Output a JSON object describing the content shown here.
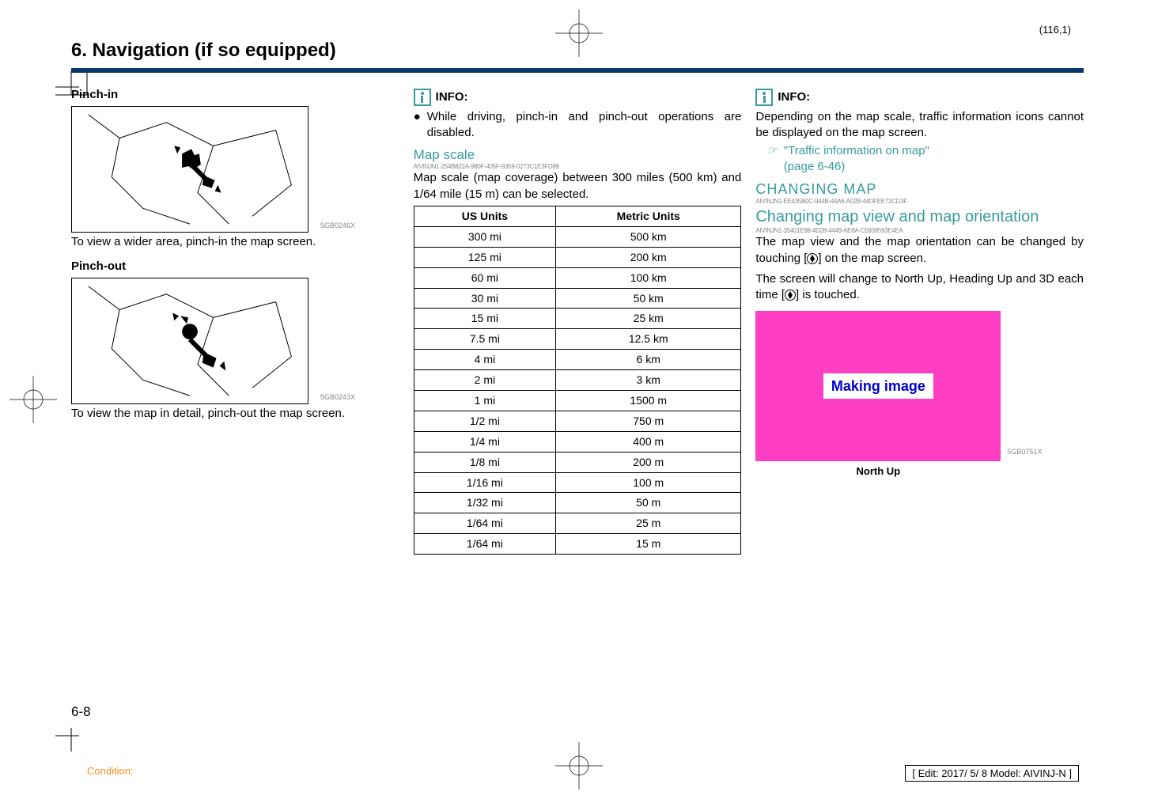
{
  "meta": {
    "pageCoord": "(116,1)",
    "condition": "Condition:",
    "editBox": "[ Edit: 2017/ 5/ 8    Model:  AIVINJ-N ]",
    "pageNumber": "6-8"
  },
  "chapterTitle": "6. Navigation (if so equipped)",
  "col1": {
    "h_pinchin": "Pinch-in",
    "fig1_label": "5GB0246X",
    "para_pinchin": "To view a wider area, pinch-in the map screen.",
    "h_pinchout": "Pinch-out",
    "fig2_label": "5GB0243X",
    "para_pinchout": "To view the map in detail, pinch-out the map screen."
  },
  "col2": {
    "info_label": "INFO:",
    "info_bullet": "While driving, pinch-in and pinch-out operations are disabled.",
    "mapscale_h": "Map scale",
    "mapscale_id": "AIVINJN1-254B822A-980F-405F-9359-0273C1E3FD89",
    "mapscale_para": "Map scale (map coverage) between 300 miles (500 km) and 1/64 mile (15 m) can be selected.",
    "th_us": "US Units",
    "th_metric": "Metric Units",
    "rows": [
      {
        "us": "300 mi",
        "m": "500 km"
      },
      {
        "us": "125 mi",
        "m": "200 km"
      },
      {
        "us": "60 mi",
        "m": "100 km"
      },
      {
        "us": "30 mi",
        "m": "50 km"
      },
      {
        "us": "15 mi",
        "m": "25 km"
      },
      {
        "us": "7.5 mi",
        "m": "12.5 km"
      },
      {
        "us": "4 mi",
        "m": "6 km"
      },
      {
        "us": "2 mi",
        "m": "3 km"
      },
      {
        "us": "1 mi",
        "m": "1500 m"
      },
      {
        "us": "1/2 mi",
        "m": "750 m"
      },
      {
        "us": "1/4 mi",
        "m": "400 m"
      },
      {
        "us": "1/8 mi",
        "m": "200 m"
      },
      {
        "us": "1/16 mi",
        "m": "100 m"
      },
      {
        "us": "1/32 mi",
        "m": "50 m"
      },
      {
        "us": "1/64 mi",
        "m": "25 m"
      },
      {
        "us": "1/64 mi",
        "m": "15 m"
      }
    ]
  },
  "col3": {
    "info_label": "INFO:",
    "info_para": "Depending on the map scale, traffic information icons cannot be displayed on the map screen.",
    "ref_text1": "\"Traffic information on map\"",
    "ref_text2": "(page 6-46)",
    "changing_h": "CHANGING MAP",
    "changing_id": "AIVINJN1-EE435B0C-944B-44A6-A02B-44DFEE72CD3F",
    "changing_sub": "Changing map view and map orientation",
    "changing_sub_id": "AIVINJN1-35401E88-4D28-4449-AE8A-C5939593E4EA",
    "para1a": "The map view and the map orientation can be changed by touching [",
    "para1b": "] on the map screen.",
    "para2a": "The screen will change to North Up, Heading Up and 3D each time [",
    "para2b": "] is touched.",
    "making": "Making image",
    "pink_label": "5GB0751X",
    "caption": "North Up"
  }
}
